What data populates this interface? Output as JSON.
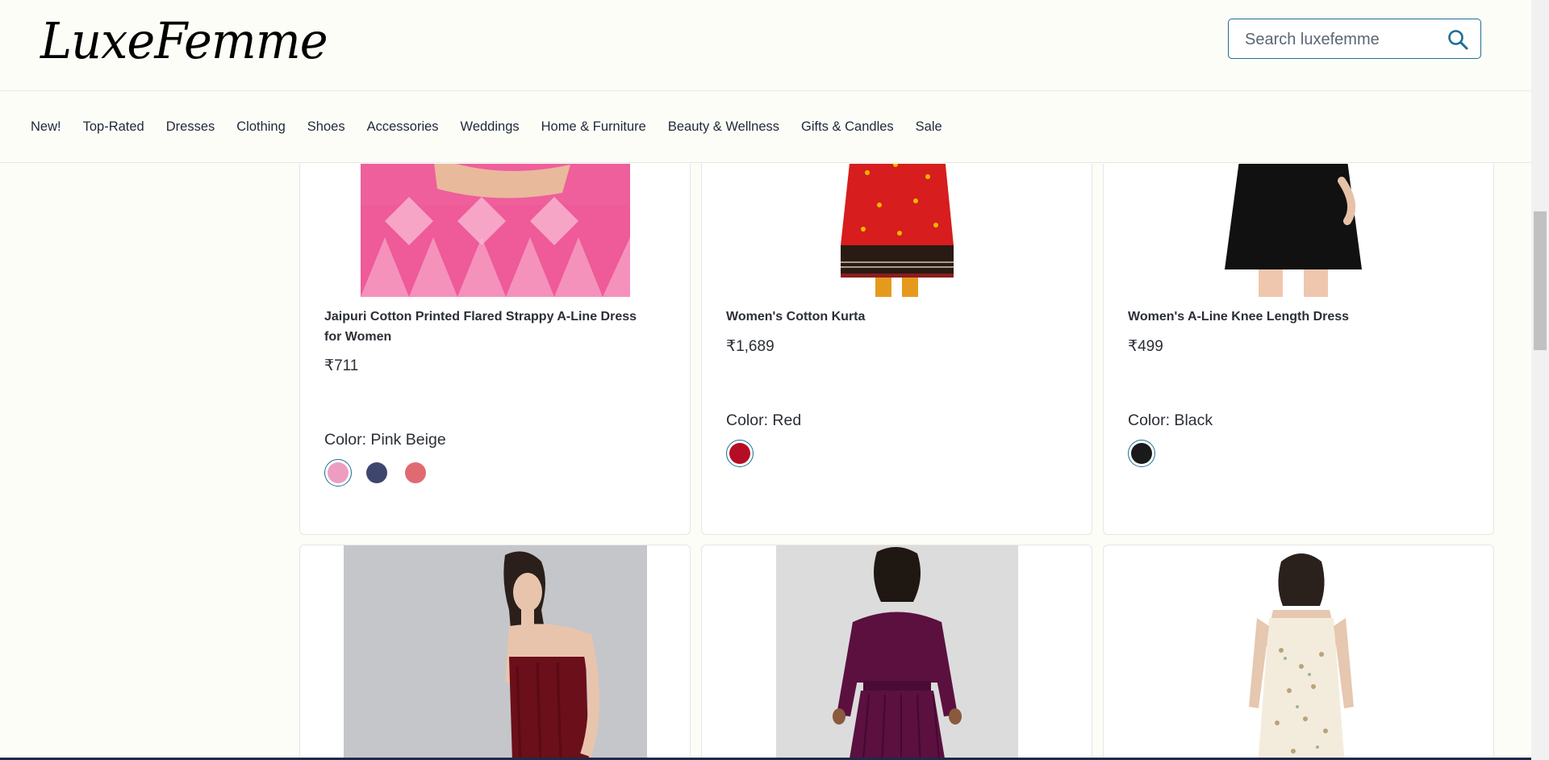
{
  "brand": {
    "logo_text": "LuxeFemme"
  },
  "search": {
    "placeholder": "Search luxefemme"
  },
  "nav": {
    "items": [
      "New!",
      "Top-Rated",
      "Dresses",
      "Clothing",
      "Shoes",
      "Accessories",
      "Weddings",
      "Home & Furniture",
      "Beauty & Wellness",
      "Gifts & Candles",
      "Sale"
    ]
  },
  "products": [
    {
      "title": "Jaipuri Cotton Printed Flared Strappy A-Line Dress for Women",
      "price": "₹711",
      "color_label": "Color: Pink Beige",
      "swatches": [
        "#ee9dc2",
        "#3f466e",
        "#e16a72"
      ],
      "selected_swatch": 0
    },
    {
      "title": "Women's Cotton Kurta",
      "price": "₹1,689",
      "color_label": "Color: Red",
      "swatches": [
        "#b50d24"
      ],
      "selected_swatch": 0
    },
    {
      "title": "Women's A-Line Knee Length Dress",
      "price": "₹499",
      "color_label": "Color: Black",
      "swatches": [
        "#1a1a1a"
      ],
      "selected_swatch": 0
    }
  ],
  "colors": {
    "accent": "#1c6f96",
    "background": "#fdfdf8"
  }
}
